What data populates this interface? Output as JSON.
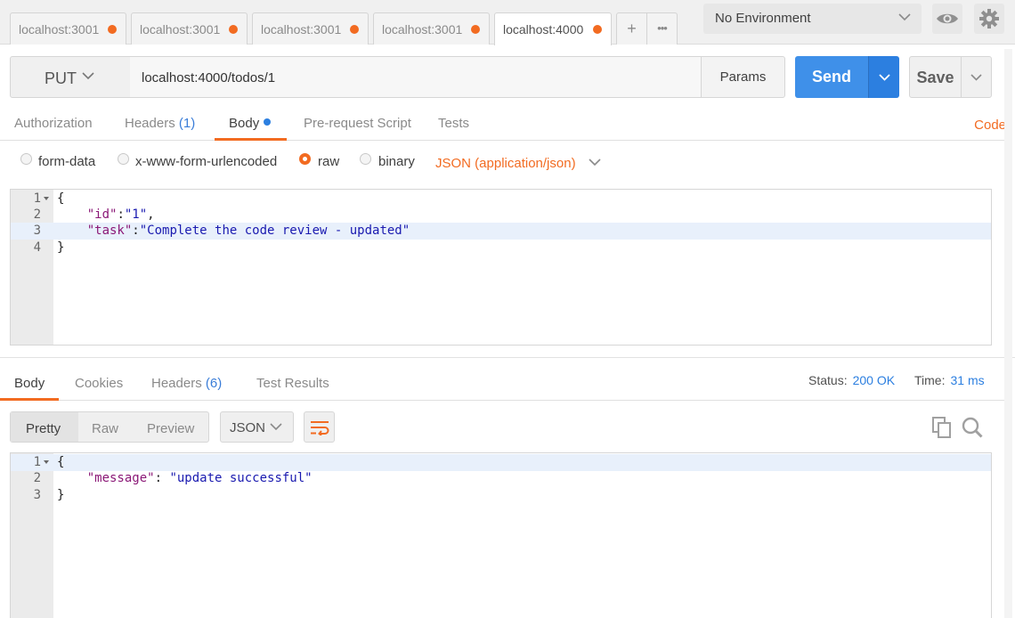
{
  "tabs": [
    {
      "label": "localhost:3001"
    },
    {
      "label": "localhost:3001"
    },
    {
      "label": "localhost:3001"
    },
    {
      "label": "localhost:3001"
    },
    {
      "label": "localhost:4000"
    }
  ],
  "tab_actions": {
    "new_tab": "+",
    "more": "•••"
  },
  "environment": {
    "selected": "No Environment"
  },
  "colors": {
    "accent": "#f26b21",
    "send": "#3f90e9",
    "link_blue": "#2c7fe0"
  },
  "request": {
    "method": "PUT",
    "url": "localhost:4000/todos/1",
    "params_label": "Params",
    "send_label": "Send",
    "save_label": "Save"
  },
  "request_tabs": {
    "authorization": "Authorization",
    "headers": "Headers",
    "headers_count": "(1)",
    "body": "Body",
    "prerequest": "Pre-request Script",
    "tests": "Tests",
    "code": "Code"
  },
  "body_types": {
    "form_data": "form-data",
    "urlencoded": "x-www-form-urlencoded",
    "raw": "raw",
    "binary": "binary",
    "content_type": "JSON (application/json)"
  },
  "request_body": {
    "line_numbers": [
      "1",
      "2",
      "3",
      "4"
    ]
  },
  "response_tabs": {
    "body": "Body",
    "cookies": "Cookies",
    "headers": "Headers",
    "headers_count": "(6)",
    "test_results": "Test Results"
  },
  "response_meta": {
    "status_label": "Status:",
    "status_value": "200 OK",
    "time_label": "Time:",
    "time_value": "31 ms"
  },
  "response_view": {
    "pretty": "Pretty",
    "raw": "Raw",
    "preview": "Preview",
    "format": "JSON"
  },
  "response_body": {
    "line_numbers": [
      "1",
      "2",
      "3"
    ]
  }
}
